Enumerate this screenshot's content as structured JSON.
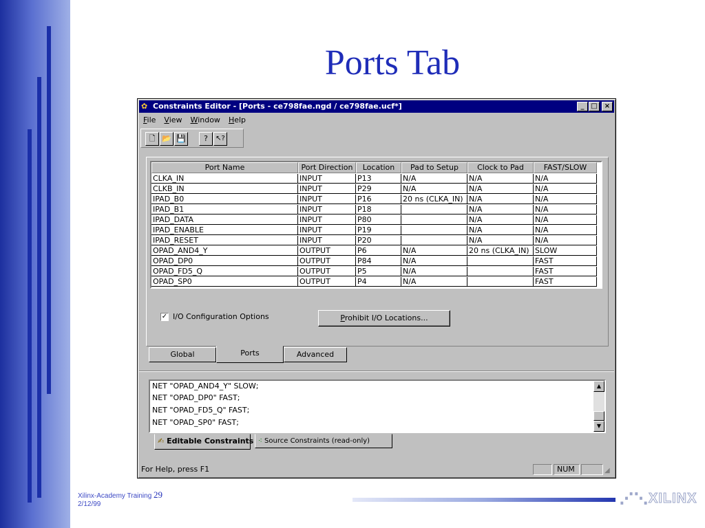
{
  "slide": {
    "title": "Ports Tab",
    "footer_org": "Xilinx-Academy Training",
    "footer_page": "29",
    "footer_date": "2/12/99",
    "logo_text": "XILINX"
  },
  "window": {
    "title": "Constraints Editor - [Ports - ce798fae.ngd / ce798fae.ucf*]",
    "controls": {
      "minimize": "_",
      "maximize": "□",
      "close": "×"
    }
  },
  "menu": [
    "File",
    "View",
    "Window",
    "Help"
  ],
  "toolbar": [
    {
      "name": "new-file-button",
      "icon": "new-file-icon",
      "glyph": "🗋"
    },
    {
      "name": "open-file-button",
      "icon": "folder-open-icon",
      "glyph": "📂"
    },
    {
      "name": "save-button",
      "icon": "save-icon",
      "glyph": "💾"
    },
    {
      "name": "help-button",
      "icon": "question-icon",
      "glyph": "?"
    },
    {
      "name": "context-help-button",
      "icon": "pointer-help-icon",
      "glyph": "↖?"
    }
  ],
  "ports_table": {
    "columns": [
      "Port Name",
      "Port Direction",
      "Location",
      "Pad to Setup",
      "Clock to Pad",
      "FAST/SLOW"
    ],
    "rows": [
      [
        "CLKA_IN",
        "INPUT",
        "P13",
        "N/A",
        "N/A",
        "N/A"
      ],
      [
        "CLKB_IN",
        "INPUT",
        "P29",
        "N/A",
        "N/A",
        "N/A"
      ],
      [
        "IPAD_B0",
        "INPUT",
        "P16",
        "20 ns (CLKA_IN)",
        "N/A",
        "N/A"
      ],
      [
        "IPAD_B1",
        "INPUT",
        "P18",
        "",
        "N/A",
        "N/A"
      ],
      [
        "IPAD_DATA",
        "INPUT",
        "P80",
        "",
        "N/A",
        "N/A"
      ],
      [
        "IPAD_ENABLE",
        "INPUT",
        "P19",
        "",
        "N/A",
        "N/A"
      ],
      [
        "IPAD_RESET",
        "INPUT",
        "P20",
        "",
        "N/A",
        "N/A"
      ],
      [
        "OPAD_AND4_Y",
        "OUTPUT",
        "P6",
        "N/A",
        "20 ns (CLKA_IN)",
        "SLOW"
      ],
      [
        "OPAD_DP0",
        "OUTPUT",
        "P84",
        "N/A",
        "",
        "FAST"
      ],
      [
        "OPAD_FD5_Q",
        "OUTPUT",
        "P5",
        "N/A",
        "",
        "FAST"
      ],
      [
        "OPAD_SP0",
        "OUTPUT",
        "P4",
        "N/A",
        "",
        "FAST"
      ]
    ]
  },
  "io_options": {
    "label": "I/O Configuration Options",
    "checked": "✓"
  },
  "prohibit_button": "Prohibit I/O Locations...",
  "tabs": [
    "Global",
    "Ports",
    "Advanced"
  ],
  "active_tab": "Ports",
  "constraints_text": [
    "NET \"OPAD_AND4_Y\" SLOW;",
    "NET \"OPAD_DP0\" FAST;",
    "NET \"OPAD_FD5_Q\" FAST;",
    "NET \"OPAD_SP0\" FAST;"
  ],
  "bottom_tabs": {
    "editable": "Editable Constraints",
    "source": "Source Constraints (read-only)"
  },
  "status": {
    "help": "For Help, press F1",
    "num": "NUM"
  }
}
